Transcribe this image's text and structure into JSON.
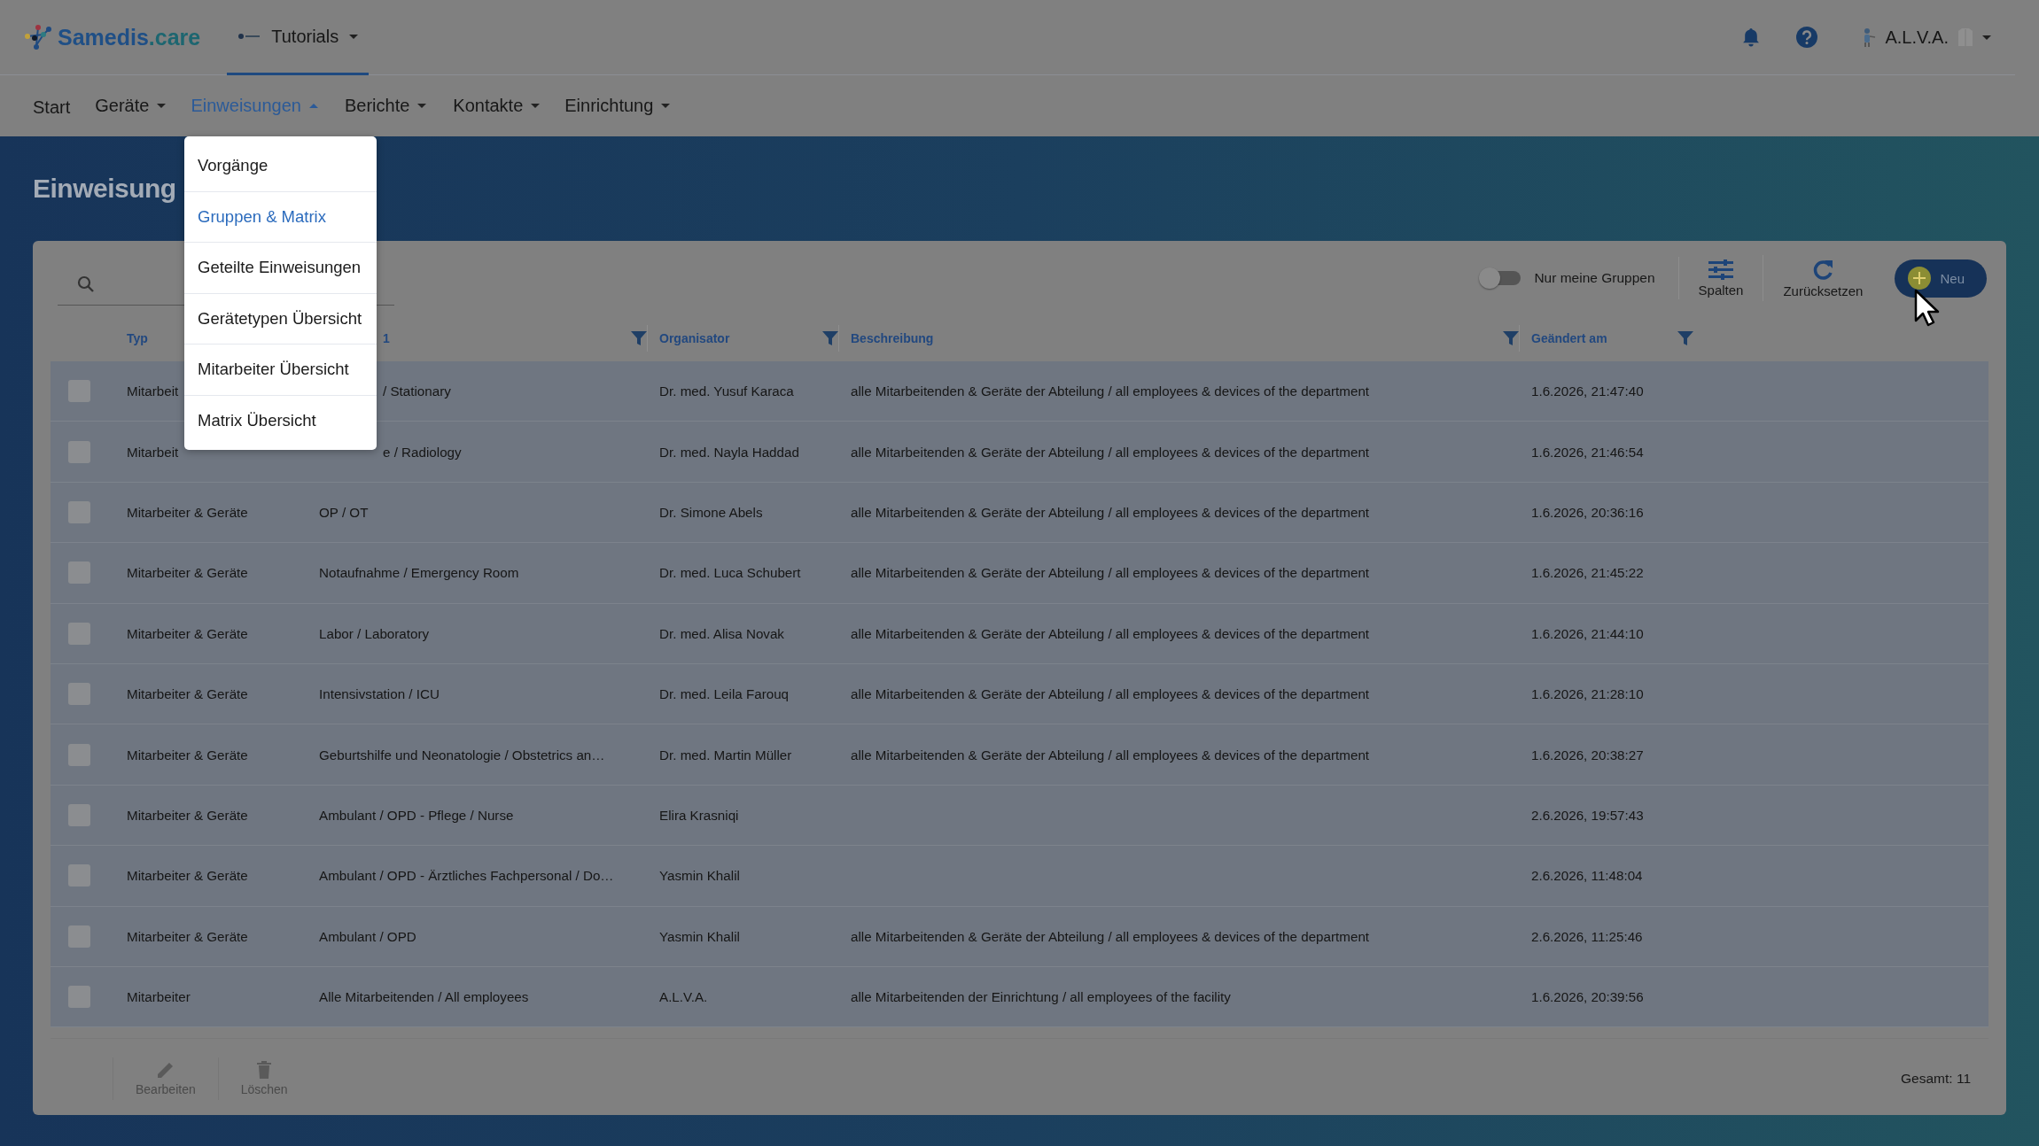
{
  "header": {
    "brand": "Samedis.care",
    "tenant": "Tutorials",
    "user": "A.L.V.A."
  },
  "nav": [
    {
      "label": "Start",
      "dropdown": false,
      "selected": false
    },
    {
      "label": "Geräte",
      "dropdown": true,
      "selected": false
    },
    {
      "label": "Einweisungen",
      "dropdown": true,
      "selected": true
    },
    {
      "label": "Berichte",
      "dropdown": true,
      "selected": false
    },
    {
      "label": "Kontakte",
      "dropdown": true,
      "selected": false
    },
    {
      "label": "Einrichtung",
      "dropdown": true,
      "selected": false
    }
  ],
  "menu": [
    {
      "label": "Vorgänge",
      "selected": false
    },
    {
      "label": "Gruppen & Matrix",
      "selected": true
    },
    {
      "label": "Geteilte Einweisungen",
      "selected": false
    },
    {
      "label": "Gerätetypen Übersicht",
      "selected": false
    },
    {
      "label": "Mitarbeiter Übersicht",
      "selected": false
    },
    {
      "label": "Matrix Übersicht",
      "selected": false
    }
  ],
  "page_title": "Einweisung",
  "toolbar": {
    "toggle": {
      "label": "Nur meine Gruppen",
      "on": false
    },
    "buttons": [
      {
        "label": "Spalten",
        "kind": "columns"
      },
      {
        "label": "Zurücksetzen",
        "kind": "reset"
      },
      {
        "label": "Neu",
        "kind": "new"
      }
    ]
  },
  "columns": [
    {
      "label": "Typ",
      "filter": false
    },
    {
      "label": "1",
      "filter": true
    },
    {
      "label": "Organisator",
      "filter": true
    },
    {
      "label": "Beschreibung",
      "filter": true
    },
    {
      "label": "Geändert am",
      "filter": true
    }
  ],
  "rows": [
    {
      "checked": false,
      "cells": [
        "Mitarbeit",
        "/ Stationary",
        "Dr. med. Yusuf Karaca",
        "alle Mitarbeitenden & Geräte der Abteilung / all employees & devices of the department",
        "1.6.2026, 21:47:40"
      ]
    },
    {
      "checked": false,
      "cells": [
        "Mitarbeit",
        "e / Radiology",
        "Dr. med. Nayla Haddad",
        "alle Mitarbeitenden & Geräte der Abteilung / all employees & devices of the department",
        "1.6.2026, 21:46:54"
      ]
    },
    {
      "checked": false,
      "cells": [
        "Mitarbeiter & Geräte",
        "OP / OT",
        "Dr. Simone Abels",
        "alle Mitarbeitenden & Geräte der Abteilung / all employees & devices of the department",
        "1.6.2026, 20:36:16"
      ]
    },
    {
      "checked": false,
      "cells": [
        "Mitarbeiter & Geräte",
        "Notaufnahme / Emergency Room",
        "Dr. med. Luca Schubert",
        "alle Mitarbeitenden & Geräte der Abteilung / all employees & devices of the department",
        "1.6.2026, 21:45:22"
      ]
    },
    {
      "checked": false,
      "cells": [
        "Mitarbeiter & Geräte",
        "Labor / Laboratory",
        "Dr. med. Alisa Novak",
        "alle Mitarbeitenden & Geräte der Abteilung / all employees & devices of the department",
        "1.6.2026, 21:44:10"
      ]
    },
    {
      "checked": false,
      "cells": [
        "Mitarbeiter & Geräte",
        "Intensivstation / ICU",
        "Dr. med. Leila Farouq",
        "alle Mitarbeitenden & Geräte der Abteilung / all employees & devices of the department",
        "1.6.2026, 21:28:10"
      ]
    },
    {
      "checked": false,
      "cells": [
        "Mitarbeiter & Geräte",
        "Geburtshilfe und Neonatologie / Obstetrics an…",
        "Dr. med. Martin Müller",
        "alle Mitarbeitenden & Geräte der Abteilung / all employees & devices of the department",
        "1.6.2026, 20:38:27"
      ]
    },
    {
      "checked": false,
      "cells": [
        "Mitarbeiter & Geräte",
        "Ambulant / OPD - Pflege / Nurse",
        "Elira Krasniqi",
        null,
        "2.6.2026, 19:57:43"
      ]
    },
    {
      "checked": false,
      "cells": [
        "Mitarbeiter & Geräte",
        "Ambulant / OPD - Ärztliches Fachpersonal / Do…",
        "Yasmin Khalil",
        null,
        "2.6.2026, 11:48:04"
      ]
    },
    {
      "checked": false,
      "cells": [
        "Mitarbeiter & Geräte",
        "Ambulant / OPD",
        "Yasmin Khalil",
        "alle Mitarbeitenden & Geräte der Abteilung / all employees & devices of the department",
        "2.6.2026, 11:25:46"
      ]
    },
    {
      "checked": false,
      "cells": [
        "Mitarbeiter",
        "Alle Mitarbeitenden / All employees",
        "A.L.V.A.",
        "alle Mitarbeitenden der Einrichtung / all employees of the facility",
        "1.6.2026, 20:39:56"
      ]
    }
  ],
  "footer": {
    "actions": [
      {
        "label": "Bearbeiten",
        "kind": "edit",
        "disabled": true
      },
      {
        "label": "Löschen",
        "kind": "delete",
        "disabled": true
      }
    ],
    "total": "Gesamt: 11"
  }
}
